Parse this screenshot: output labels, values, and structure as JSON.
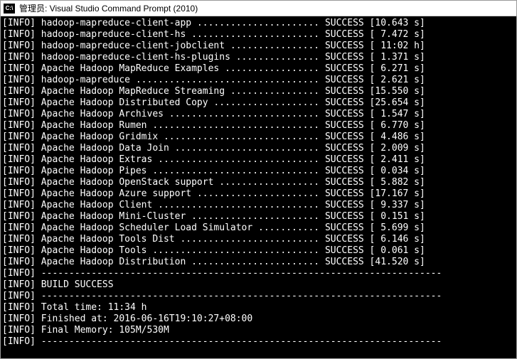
{
  "window": {
    "title": "管理员: Visual Studio Command Prompt (2010)",
    "icon_text": "C:\\"
  },
  "log": {
    "prefix": "[INFO]",
    "separator": "------------------------------------------------------------------------",
    "status_label": "SUCCESS",
    "success_line": "BUILD SUCCESS",
    "total_time_label": "Total time:",
    "total_time_value": "11:34 h",
    "finished_label": "Finished at:",
    "finished_value": "2016-06-16T19:10:27+08:00",
    "memory_label": "Final Memory:",
    "memory_value": "105M/530M",
    "rows": [
      {
        "name": "hadoop-mapreduce-client-app",
        "time": "10.643 s"
      },
      {
        "name": "hadoop-mapreduce-client-hs",
        "time": "7.472 s"
      },
      {
        "name": "hadoop-mapreduce-client-jobclient",
        "time": "11:02 h"
      },
      {
        "name": "hadoop-mapreduce-client-hs-plugins",
        "time": "1.371 s"
      },
      {
        "name": "Apache Hadoop MapReduce Examples",
        "time": "6.271 s"
      },
      {
        "name": "hadoop-mapreduce",
        "time": "2.621 s"
      },
      {
        "name": "Apache Hadoop MapReduce Streaming",
        "time": "15.550 s"
      },
      {
        "name": "Apache Hadoop Distributed Copy",
        "time": "25.654 s"
      },
      {
        "name": "Apache Hadoop Archives",
        "time": "1.547 s"
      },
      {
        "name": "Apache Hadoop Rumen",
        "time": "6.770 s"
      },
      {
        "name": "Apache Hadoop Gridmix",
        "time": "4.486 s"
      },
      {
        "name": "Apache Hadoop Data Join",
        "time": "2.009 s"
      },
      {
        "name": "Apache Hadoop Extras",
        "time": "2.411 s"
      },
      {
        "name": "Apache Hadoop Pipes",
        "time": "0.034 s"
      },
      {
        "name": "Apache Hadoop OpenStack support",
        "time": "5.882 s"
      },
      {
        "name": "Apache Hadoop Azure support",
        "time": "17.167 s"
      },
      {
        "name": "Apache Hadoop Client",
        "time": "9.337 s"
      },
      {
        "name": "Apache Hadoop Mini-Cluster",
        "time": "0.151 s"
      },
      {
        "name": "Apache Hadoop Scheduler Load Simulator",
        "time": "5.699 s"
      },
      {
        "name": "Apache Hadoop Tools Dist",
        "time": "6.146 s"
      },
      {
        "name": "Apache Hadoop Tools",
        "time": "0.061 s"
      },
      {
        "name": "Apache Hadoop Distribution",
        "time": "41.520 s"
      }
    ]
  },
  "layout": {
    "name_col_width": 50,
    "status_col_start": 58,
    "time_col_start": 68,
    "time_col_width": 8
  }
}
